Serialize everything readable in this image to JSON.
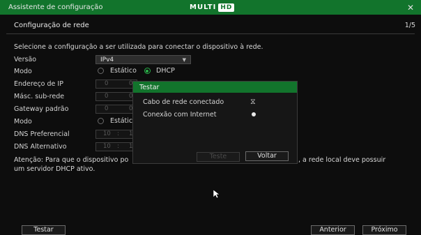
{
  "window": {
    "title": "Assistente de configuração",
    "close": "✕",
    "logo_main": "MULTI",
    "logo_hd": "HD"
  },
  "header": {
    "title": "Configuração de rede",
    "page": "1/5"
  },
  "intro": "Selecione a configuração a ser utilizada para conectar o dispositivo à rede.",
  "form": {
    "versao_label": "Versão",
    "versao_value": "IPv4",
    "modo_label": "Modo",
    "modo_opt_static": "Estático",
    "modo_opt_dhcp": "DHCP",
    "ip_label": "Endereço de IP",
    "mask_label": "Másc. sub-rede",
    "gateway_label": "Gateway padrão",
    "modo2_label": "Modo",
    "modo2_opt_static": "Estátic",
    "dns1_label": "DNS Preferencial",
    "dns2_label": "DNS Alternativo",
    "ip_octet": "0",
    "dns_octet": "10",
    "dns_octet2": "1"
  },
  "note": {
    "line1_start": "Atenção: Para que o dispositivo po",
    "line1_end": ", a rede local deve possuir",
    "line2": "um servidor DHCP ativo."
  },
  "dialog": {
    "title": "Testar",
    "row1_label": "Cabo de rede conectado",
    "row1_icon": "hourglass-icon",
    "row2_label": "Conexão com Internet",
    "row2_icon": "dot-icon",
    "test_button": "Teste",
    "back_button": "Voltar"
  },
  "footer": {
    "test_button": "Testar",
    "prev_button": "Anterior",
    "next_button": "Próximo"
  },
  "colors": {
    "accent": "#12742c",
    "radio_on": "#29b34a"
  }
}
